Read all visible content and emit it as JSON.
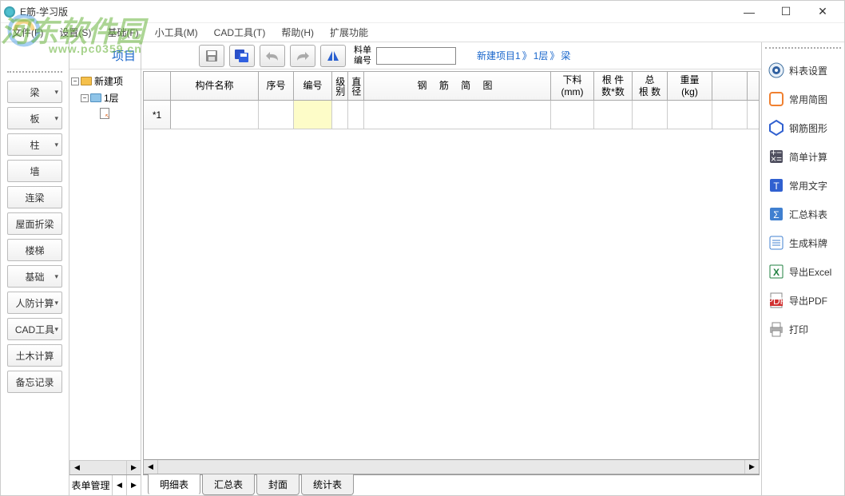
{
  "window": {
    "title": "E筋-学习版",
    "minimize": "—",
    "maximize": "☐",
    "close": "✕"
  },
  "menu": [
    "文件(F)",
    "设置(S)",
    "基础(F)",
    "小工具(M)",
    "CAD工具(T)",
    "帮助(H)",
    "扩展功能"
  ],
  "watermark": {
    "main": "河东软件园",
    "sub": "www.pc0359.cn"
  },
  "left_sidebar": {
    "items": [
      {
        "label": "梁",
        "dd": true
      },
      {
        "label": "板",
        "dd": true
      },
      {
        "label": "柱",
        "dd": true
      },
      {
        "label": "墙",
        "dd": false
      },
      {
        "label": "连梁",
        "dd": false
      },
      {
        "label": "屋面折梁",
        "dd": false
      },
      {
        "label": "楼梯",
        "dd": false
      },
      {
        "label": "基础",
        "dd": true
      },
      {
        "label": "人防计算",
        "dd": true
      },
      {
        "label": "CAD工具",
        "dd": true
      },
      {
        "label": "土木计算",
        "dd": false
      },
      {
        "label": "备忘记录",
        "dd": false
      }
    ]
  },
  "tree": {
    "header": "项目",
    "nodes": [
      {
        "level": 0,
        "expanded": true,
        "type": "folder",
        "label": "新建项"
      },
      {
        "level": 1,
        "expanded": true,
        "type": "folder-open",
        "label": "1层"
      },
      {
        "level": 2,
        "expanded": false,
        "type": "doc",
        "label": ""
      }
    ],
    "footer": "表单管理"
  },
  "toolbar": {
    "bill_label": "料单\n编号",
    "bill_value": ""
  },
  "breadcrumb": {
    "p1": "新建项目1",
    "p2": "1层",
    "p3": "梁",
    "sep": "》"
  },
  "grid": {
    "headers": [
      "",
      "构件名称",
      "序号",
      "编号",
      "级别",
      "直径",
      "钢 筋 简 图",
      "下料\n(mm)",
      "根 件\n数*数",
      "总\n根 数",
      "重量\n(kg)",
      ""
    ],
    "rows": [
      {
        "rownum": "*1",
        "cells": [
          "",
          "",
          "",
          "",
          "",
          "",
          "",
          "",
          "",
          "",
          ""
        ]
      }
    ]
  },
  "tabs": [
    "明细表",
    "汇总表",
    "封面",
    "统计表"
  ],
  "right_sidebar": [
    {
      "icon": "gear",
      "label": "料表设置"
    },
    {
      "icon": "doc-orange",
      "label": "常用简图"
    },
    {
      "icon": "hex",
      "label": "钢筋图形"
    },
    {
      "icon": "calc",
      "label": "简单计算"
    },
    {
      "icon": "text",
      "label": "常用文字"
    },
    {
      "icon": "sigma",
      "label": "汇总料表"
    },
    {
      "icon": "list",
      "label": "生成料牌"
    },
    {
      "icon": "excel",
      "label": "导出Excel"
    },
    {
      "icon": "pdf",
      "label": "导出PDF"
    },
    {
      "icon": "print",
      "label": "打印"
    }
  ]
}
